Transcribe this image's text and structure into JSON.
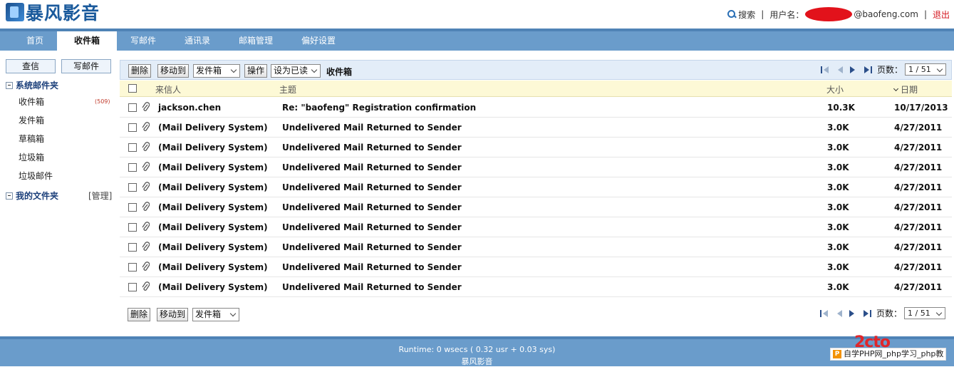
{
  "header": {
    "logo_text": "暴风影音",
    "search_label": "搜索",
    "separator": "|",
    "user_label": "用户名：",
    "user_domain": "@baofeng.com",
    "logout_label": "退出"
  },
  "nav": {
    "tabs": [
      {
        "label": "首页",
        "active": false
      },
      {
        "label": "收件箱",
        "active": true
      },
      {
        "label": "写邮件",
        "active": false
      },
      {
        "label": "通讯录",
        "active": false
      },
      {
        "label": "邮箱管理",
        "active": false
      },
      {
        "label": "偏好设置",
        "active": false
      }
    ]
  },
  "sidebar": {
    "check_mail_label": "查信",
    "compose_label": "写邮件",
    "system_folders_label": "系统邮件夹",
    "folders": [
      {
        "label": "收件箱",
        "badge": "(509)"
      },
      {
        "label": "发件箱",
        "badge": ""
      },
      {
        "label": "草稿箱",
        "badge": ""
      },
      {
        "label": "垃圾箱",
        "badge": ""
      },
      {
        "label": "垃圾邮件",
        "badge": ""
      }
    ],
    "my_folders_label": "我的文件夹",
    "manage_label": "[管理]"
  },
  "toolbar": {
    "delete_label": "删除",
    "move_to_label": "移动到",
    "move_target": "发件箱",
    "operate_label": "操作",
    "mark_as": "设为已读",
    "folder_title": "收件箱",
    "page_label": "页数：",
    "page_value": "1 / 51"
  },
  "list": {
    "headers": {
      "from": "来信人",
      "subject": "主题",
      "size": "大小",
      "date": "日期"
    },
    "rows": [
      {
        "from": "jackson.chen",
        "subject": "Re: \"baofeng\" Registration confirmation",
        "size": "10.3K",
        "date": "10/17/2013"
      },
      {
        "from": "(Mail Delivery System)",
        "subject": "Undelivered Mail Returned to Sender",
        "size": "3.0K",
        "date": "4/27/2011"
      },
      {
        "from": "(Mail Delivery System)",
        "subject": "Undelivered Mail Returned to Sender",
        "size": "3.0K",
        "date": "4/27/2011"
      },
      {
        "from": "(Mail Delivery System)",
        "subject": "Undelivered Mail Returned to Sender",
        "size": "3.0K",
        "date": "4/27/2011"
      },
      {
        "from": "(Mail Delivery System)",
        "subject": "Undelivered Mail Returned to Sender",
        "size": "3.0K",
        "date": "4/27/2011"
      },
      {
        "from": "(Mail Delivery System)",
        "subject": "Undelivered Mail Returned to Sender",
        "size": "3.0K",
        "date": "4/27/2011"
      },
      {
        "from": "(Mail Delivery System)",
        "subject": "Undelivered Mail Returned to Sender",
        "size": "3.0K",
        "date": "4/27/2011"
      },
      {
        "from": "(Mail Delivery System)",
        "subject": "Undelivered Mail Returned to Sender",
        "size": "3.0K",
        "date": "4/27/2011"
      },
      {
        "from": "(Mail Delivery System)",
        "subject": "Undelivered Mail Returned to Sender",
        "size": "3.0K",
        "date": "4/27/2011"
      },
      {
        "from": "(Mail Delivery System)",
        "subject": "Undelivered Mail Returned to Sender",
        "size": "3.0K",
        "date": "4/27/2011"
      }
    ]
  },
  "bottom_toolbar": {
    "delete_label": "删除",
    "move_to_label": "移动到",
    "move_target": "发件箱",
    "page_label": "页数：",
    "page_value": "1 / 51"
  },
  "footer": {
    "runtime": "Runtime: 0 wsecs ( 0.32 usr + 0.03 sys)",
    "brand": "暴风影音"
  },
  "watermark": {
    "text": "自学PHP网_php学习_php教"
  },
  "colors": {
    "nav_bg": "#6a9ccb",
    "nav_border": "#4f83b6",
    "accent_red": "#d4161e",
    "header_row_bg": "#fdf9d6",
    "toolbar_bg": "#e3edf8"
  }
}
